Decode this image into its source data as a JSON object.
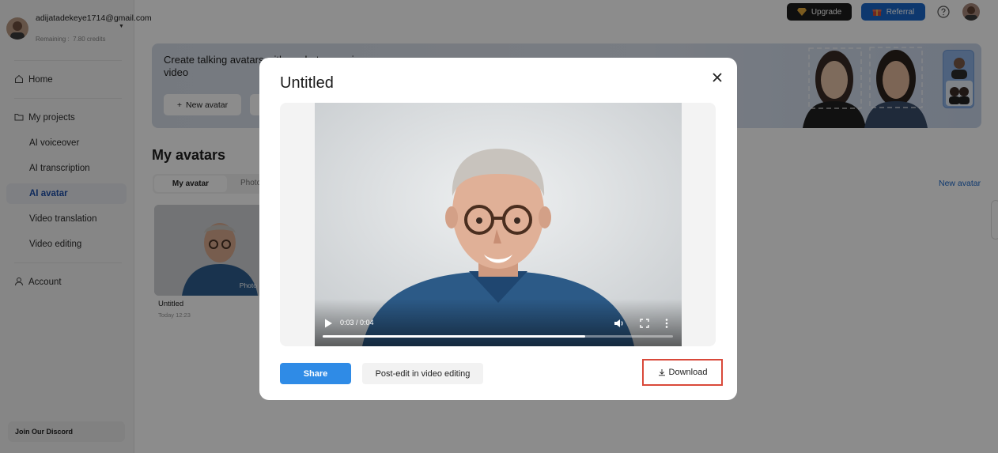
{
  "account": {
    "email": "adijatadekeye1714@gmail.com",
    "credits": "Remaining :  7.80 credits"
  },
  "sidebar": {
    "items": [
      {
        "label": "Home",
        "icon": "home-icon"
      },
      {
        "label": "My projects",
        "icon": "folder-icon"
      },
      {
        "label": "AI voiceover"
      },
      {
        "label": "AI transcription"
      },
      {
        "label": "AI avatar",
        "active": true
      },
      {
        "label": "Video translation"
      },
      {
        "label": "Video editing"
      },
      {
        "label": "Account",
        "icon": "user-icon"
      }
    ],
    "discord": "Join Our Discord"
  },
  "topbar": {
    "upgrade": "Upgrade",
    "referral": "Referral"
  },
  "banner": {
    "text": "Create talking avatars with a  photo-   or  image or a video",
    "new_avatar": "New avatar"
  },
  "page": {
    "title": "My avatars",
    "tab_active": "My avatar",
    "tab_photo": "Photo",
    "new_avatar_link": "New avatar"
  },
  "card": {
    "badge": "Photo",
    "title": "Untitled",
    "date": "Today 12:23"
  },
  "modal": {
    "title": "Untitled",
    "time": "0:03 / 0:04",
    "progress": 0.75,
    "share": "Share",
    "postedit": "Post-edit in video editing",
    "download": "Download"
  },
  "colors": {
    "accent": "#1a66c8",
    "share": "#2f8be6",
    "highlight": "#d9493a"
  }
}
